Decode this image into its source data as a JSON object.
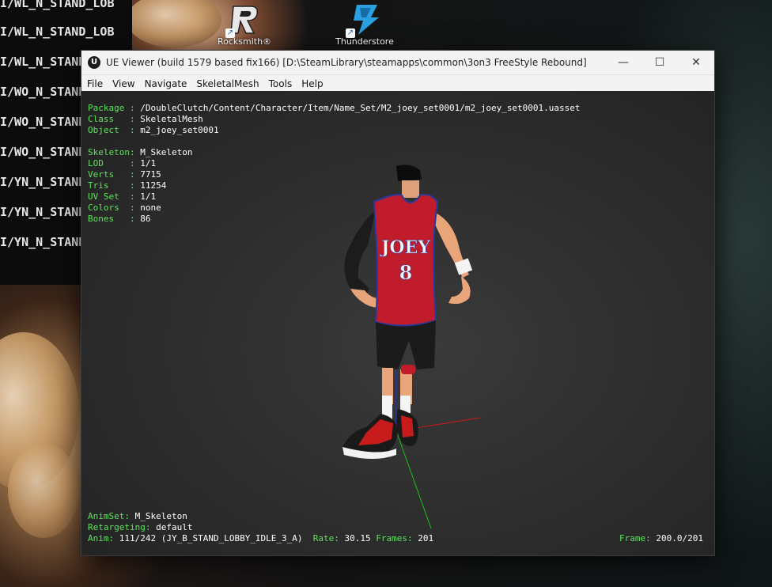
{
  "terminal": {
    "lines": [
      "I/WL_N_STAND_LOB",
      "I/WL_N_STAND_LOB",
      "I/WL_N_STAND",
      "I/WO_N_STAND",
      "I/WO_N_STAND",
      "I/WO_N_STAND",
      "I/YN_N_STAND",
      "I/YN_N_STAND",
      "I/YN_N_STAND"
    ]
  },
  "desktop": {
    "icons": [
      {
        "label": "Rocksmith®",
        "icon": "rocksmith-icon"
      },
      {
        "label": "Thunderstore",
        "icon": "thunderstore-icon"
      }
    ]
  },
  "window": {
    "title": "UE Viewer (build 1579 based fix166) [D:\\SteamLibrary\\steamapps\\common\\3on3 FreeStyle Rebound]",
    "controls": {
      "minimize": "—",
      "maximize": "☐",
      "close": "✕"
    },
    "menu": [
      "File",
      "View",
      "Navigate",
      "SkeletalMesh",
      "Tools",
      "Help"
    ]
  },
  "info": {
    "package_label": "Package :",
    "package_value": "/DoubleClutch/Content/Character/Item/Name_Set/M2_joey_set0001/m2_joey_set0001.uasset",
    "class_label": "Class   :",
    "class_value": "SkeletalMesh",
    "object_label": "Object  :",
    "object_value": "m2_joey_set0001",
    "skeleton_label": "Skeleton:",
    "skeleton_value": "M_Skeleton",
    "lod_label": "LOD     :",
    "lod_value": "1/1",
    "verts_label": "Verts   :",
    "verts_value": "7715",
    "tris_label": "Tris    :",
    "tris_value": "11254",
    "uvset_label": "UV Set  :",
    "uvset_value": "1/1",
    "colors_label": "Colors  :",
    "colors_value": "none",
    "bones_label": "Bones   :",
    "bones_value": "86"
  },
  "anim": {
    "animset_label": "AnimSet:",
    "animset_value": "M_Skeleton",
    "retarget_label": "Retargeting:",
    "retarget_value": "default",
    "anim_label": "Anim:",
    "anim_value": "111/242 (JY_B_STAND_LOBBY_IDLE_3_A)",
    "rate_label": "Rate:",
    "rate_value": "30.15",
    "frames_label": "Frames:",
    "frames_value": "201",
    "frame_label": "Frame:",
    "frame_value": "200.0/201"
  },
  "model": {
    "jersey_name": "JOEY",
    "jersey_number": "8",
    "colors": {
      "jersey": "#c01c2c",
      "trim": "#2a3a9a",
      "shorts": "#1b1b1b",
      "skin": "#e8a57a"
    }
  }
}
